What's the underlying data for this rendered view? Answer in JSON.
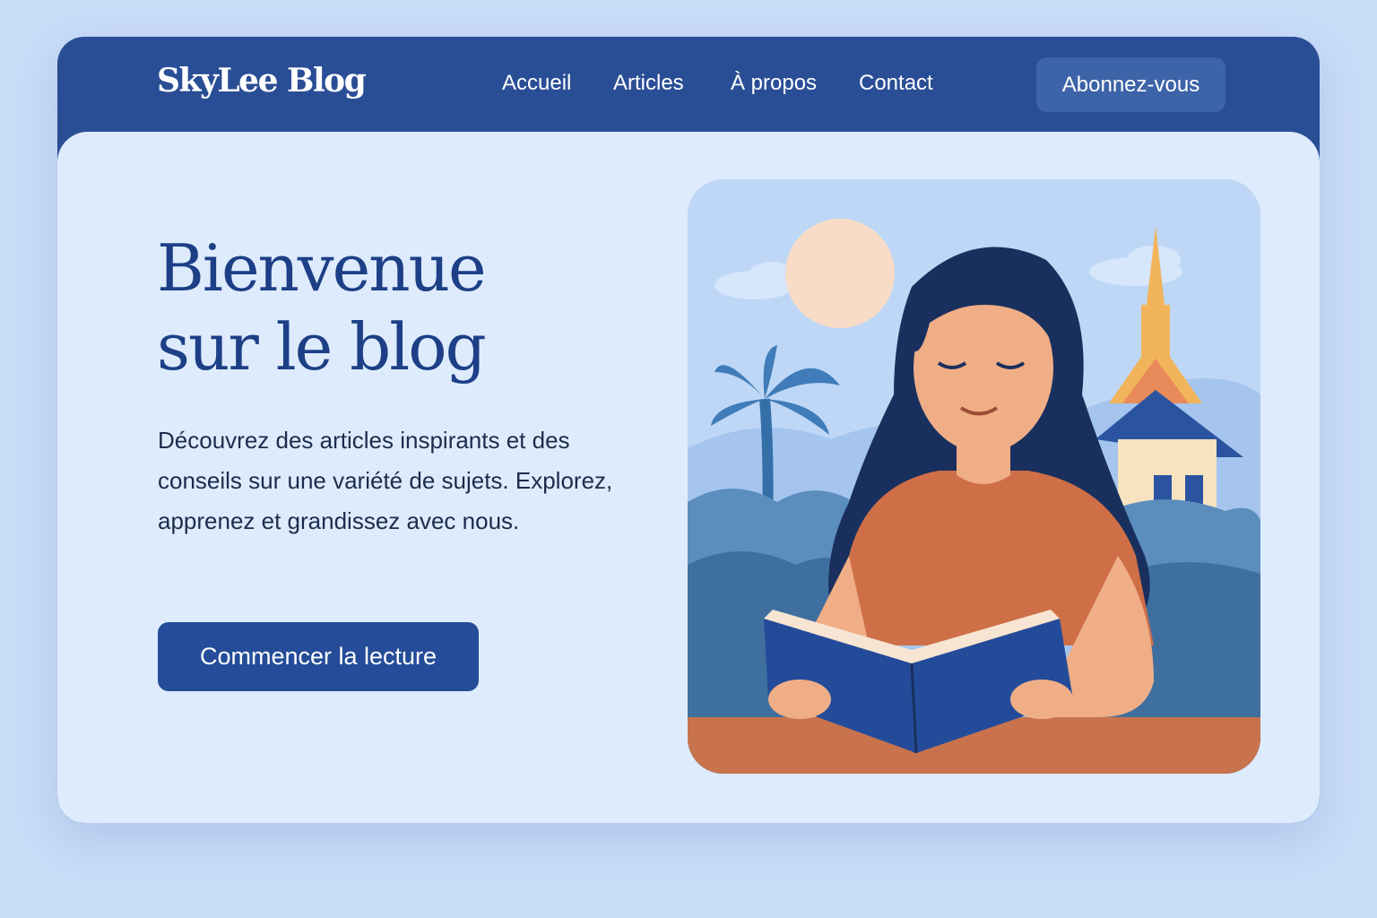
{
  "header": {
    "logo": "SkyLee Blog",
    "nav": [
      {
        "label": "Accueil"
      },
      {
        "label": "Articles"
      },
      {
        "label": "À propos"
      },
      {
        "label": "Contact"
      }
    ],
    "subscribe_label": "Abonnez-vous"
  },
  "hero": {
    "title_line1": "Bienvenue",
    "title_line2": "sur le blog",
    "description": "Découvrez des articles inspirants et des conseils sur une variété de sujets. Explorez, apprenez et grandissez avec nous.",
    "cta_label": "Commencer la lecture"
  },
  "colors": {
    "brand": "#2a4e96",
    "background": "#c9dcf8",
    "surface": "#deebfc",
    "title": "#1c3f86",
    "cta": "#254c98"
  },
  "illustration": {
    "subject": "woman-reading-book",
    "elements": [
      "sun-icon",
      "palm-tree-icon",
      "temple-icon",
      "cloud-icon",
      "book-icon"
    ]
  }
}
